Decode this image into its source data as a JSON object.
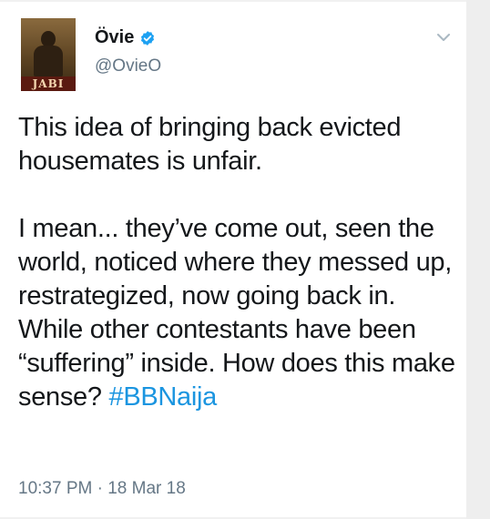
{
  "author": {
    "name": "Övie",
    "handle": "@OvieO",
    "avatar_text": "JABI"
  },
  "tweet": {
    "paragraph1": "This idea of bringing back evicted housemates is unfair.",
    "paragraph2_text": "I mean... they’ve come out, seen the world, noticed where they messed up, restrategized, now going back in. While other contestants have been “suffering” inside. How does this make sense? ",
    "hashtag": "#BBNaija"
  },
  "meta": {
    "time": "10:37 PM",
    "separator": "·",
    "date": "18 Mar 18"
  },
  "icons": {
    "verified": "verified-badge-icon",
    "menu": "chevron-down-icon"
  },
  "colors": {
    "text": "#14171a",
    "secondary": "#657786",
    "accent": "#1b95e0",
    "verified": "#1da1f2"
  }
}
